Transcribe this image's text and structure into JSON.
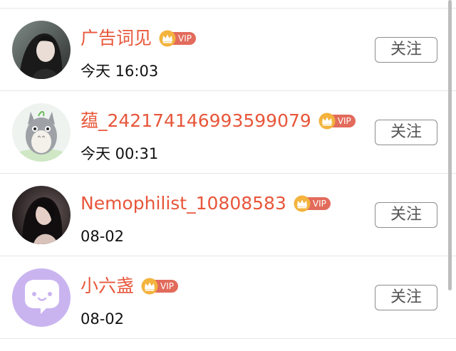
{
  "follow_list": {
    "items": [
      {
        "name": "广告词见",
        "time": "今天 16:03",
        "vip_label": "VIP",
        "follow_label": "关注",
        "avatar_icon": "portrait-photo-dark"
      },
      {
        "name": "蕴_242174146993599079",
        "time": "今天 00:31",
        "vip_label": "VIP",
        "follow_label": "关注",
        "avatar_icon": "totoro-illustration"
      },
      {
        "name": "Nemophilist_10808583",
        "time": "08-02",
        "vip_label": "VIP",
        "follow_label": "关注",
        "avatar_icon": "portrait-photo-girl"
      },
      {
        "name": "小六盏",
        "time": "08-02",
        "vip_label": "VIP",
        "follow_label": "关注",
        "avatar_icon": "default-chat-bubble-avatar"
      }
    ]
  },
  "colors": {
    "name": "#e8563a",
    "vip_pill": "#e26b5b",
    "vip_crown": "#f3b33d",
    "button_border": "#8d8d8d",
    "divider": "#e6e6e6",
    "default_avatar_bg": "#c9b4f0"
  }
}
